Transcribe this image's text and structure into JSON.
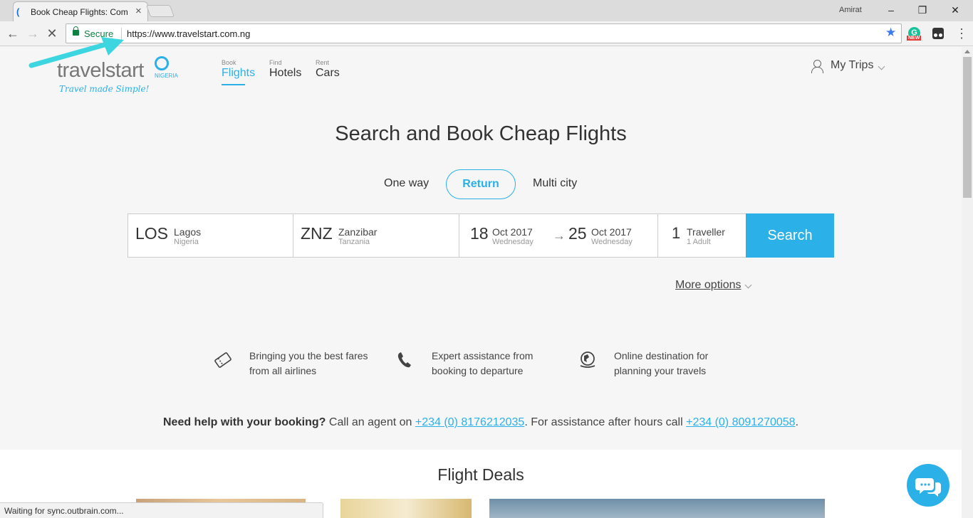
{
  "browser": {
    "tab_title": "Book Cheap Flights: Com",
    "profile_name": "Amirat",
    "secure_label": "Secure",
    "url": "https://www.travelstart.com.ng",
    "extension_badge": "NEW",
    "status_text": "Waiting for sync.outbrain.com..."
  },
  "header": {
    "logo_text": "travelstart",
    "logo_country": "NIGERIA",
    "logo_tagline": "Travel made Simple!",
    "nav": [
      {
        "small": "Book",
        "label": "Flights"
      },
      {
        "small": "Find",
        "label": "Hotels"
      },
      {
        "small": "Rent",
        "label": "Cars"
      }
    ],
    "my_trips": "My Trips"
  },
  "hero": {
    "title": "Search and Book Cheap Flights",
    "trip_types": [
      "One way",
      "Return",
      "Multi city"
    ],
    "selected_trip_type": "Return"
  },
  "search": {
    "from": {
      "code": "LOS",
      "city": "Lagos",
      "country": "Nigeria"
    },
    "to": {
      "code": "ZNZ",
      "city": "Zanzibar",
      "country": "Tanzania"
    },
    "depart": {
      "day": "18",
      "month": "Oct 2017",
      "weekday": "Wednesday"
    },
    "return": {
      "day": "25",
      "month": "Oct 2017",
      "weekday": "Wednesday"
    },
    "travellers": {
      "count": "1",
      "label": "Traveller",
      "detail": "1 Adult"
    },
    "button": "Search",
    "more_options": "More options"
  },
  "features": [
    {
      "icon": "ticket-icon",
      "line1": "Bringing you the best fares",
      "line2": "from all airlines"
    },
    {
      "icon": "phone-icon",
      "line1": "Expert assistance from",
      "line2": "booking to departure"
    },
    {
      "icon": "globe-icon",
      "line1": "Online destination for",
      "line2": "planning your travels"
    }
  ],
  "help": {
    "bold": "Need help with your booking?",
    "text1": " Call an agent on ",
    "phone1": "+234 (0) 8176212035",
    "text2": ". For assistance after hours call ",
    "phone2": "+234 (0) 8091270058",
    "text3": "."
  },
  "deals": {
    "title": "Flight Deals"
  },
  "colors": {
    "accent": "#2bb0e8",
    "annotation_arrow": "#3dd6e0",
    "secure_green": "#0b8043"
  }
}
